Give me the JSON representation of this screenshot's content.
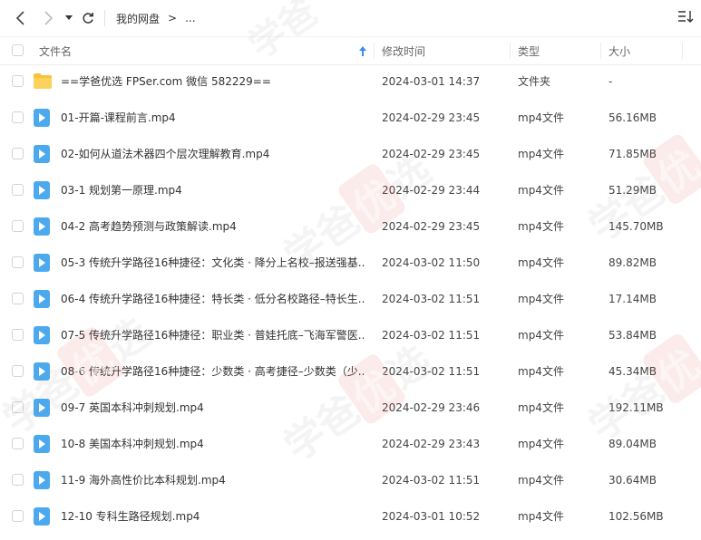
{
  "toolbar": {
    "breadcrumb_root": "我的网盘",
    "breadcrumb_sep": ">",
    "breadcrumb_more": "..."
  },
  "columns": {
    "name": "文件名",
    "mtime": "修改时间",
    "type": "类型",
    "size": "大小"
  },
  "colors": {
    "folder": "#F9C23C",
    "video": "#4DA9EE",
    "sort_arrow": "#3C8CF0"
  },
  "files": [
    {
      "name": "==学爸优选 FPSer.com 微信 582229==",
      "date": "2024-03-01 14:37",
      "type": "文件夹",
      "size": "-",
      "icon": "folder-icon"
    },
    {
      "name": "01-开篇-课程前言.mp4",
      "date": "2024-02-29 23:45",
      "type": "mp4文件",
      "size": "56.16MB",
      "icon": "video-file-icon"
    },
    {
      "name": "02-如何从道法术器四个层次理解教育.mp4",
      "date": "2024-02-29 23:45",
      "type": "mp4文件",
      "size": "71.85MB",
      "icon": "video-file-icon"
    },
    {
      "name": "03-1 规划第一原理.mp4",
      "date": "2024-02-29 23:44",
      "type": "mp4文件",
      "size": "51.29MB",
      "icon": "video-file-icon"
    },
    {
      "name": "04-2 高考趋势预测与政策解读.mp4",
      "date": "2024-02-29 23:45",
      "type": "mp4文件",
      "size": "145.70MB",
      "icon": "video-file-icon"
    },
    {
      "name": "05-3 传统升学路径16种捷径：文化类 · 降分上名校–报送强基....",
      "date": "2024-03-02 11:50",
      "type": "mp4文件",
      "size": "89.82MB",
      "icon": "video-file-icon"
    },
    {
      "name": "06-4 传统升学路径16种捷径：特长类 · 低分名校路径–特长生....",
      "date": "2024-03-02 11:51",
      "type": "mp4文件",
      "size": "17.14MB",
      "icon": "video-file-icon"
    },
    {
      "name": "07-5 传统升学路径16种捷径：职业类 · 普娃托底–飞海军警医...",
      "date": "2024-03-02 11:51",
      "type": "mp4文件",
      "size": "53.84MB",
      "icon": "video-file-icon"
    },
    {
      "name": "08-6 传统升学路径16种捷径：少数类 · 高考捷径–少数类（少...",
      "date": "2024-03-02 11:51",
      "type": "mp4文件",
      "size": "45.34MB",
      "icon": "video-file-icon"
    },
    {
      "name": "09-7 英国本科冲刺规划.mp4",
      "date": "2024-02-29 23:46",
      "type": "mp4文件",
      "size": "192.11MB",
      "icon": "video-file-icon"
    },
    {
      "name": "10-8 美国本科冲刺规划.mp4",
      "date": "2024-02-29 23:43",
      "type": "mp4文件",
      "size": "89.04MB",
      "icon": "video-file-icon"
    },
    {
      "name": "11-9 海外高性价比本科规划.mp4",
      "date": "2024-03-02 11:51",
      "type": "mp4文件",
      "size": "30.64MB",
      "icon": "video-file-icon"
    },
    {
      "name": "12-10 专科生路径规划.mp4",
      "date": "2024-03-01 10:52",
      "type": "mp4文件",
      "size": "102.56MB",
      "icon": "video-file-icon"
    }
  ],
  "watermark": {
    "text_a": "学爸",
    "text_b": "优",
    "text_c": "选"
  }
}
